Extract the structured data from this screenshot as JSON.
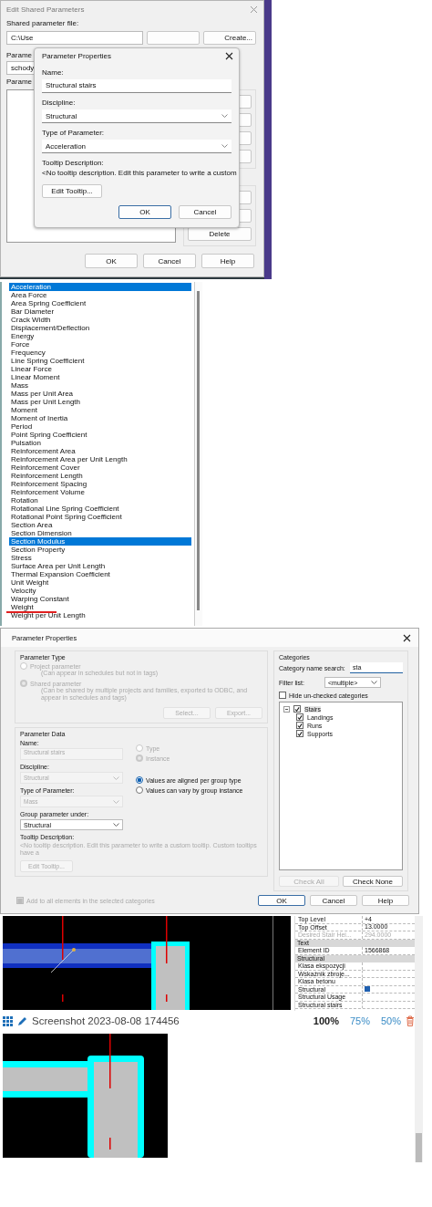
{
  "edit_shared_parameters": {
    "title": "Edit Shared Parameters",
    "file_label": "Shared parameter file:",
    "file_path": "C:\\Use",
    "create_button": "Create...",
    "group_label": "Parame",
    "group_value": "schody",
    "params_label": "Parame",
    "delete_button": "Delete",
    "footer_buttons": [
      "OK",
      "Cancel",
      "Help"
    ]
  },
  "parameter_properties_small": {
    "title": "Parameter Properties",
    "name_label": "Name:",
    "name_value": "Structural stairs",
    "discipline_label": "Discipline:",
    "discipline_value": "Structural",
    "type_label": "Type of Parameter:",
    "type_value": "Acceleration",
    "tooltip_label": "Tooltip Description:",
    "tooltip_text": "<No tooltip description. Edit this parameter to write a custom",
    "edit_tooltip_button": "Edit Tooltip...",
    "ok_button": "OK",
    "cancel_button": "Cancel"
  },
  "parameter_type_list": {
    "items": [
      {
        "label": "Acceleration",
        "selected": true,
        "underlined": false
      },
      {
        "label": "Area Force",
        "selected": false,
        "underlined": false
      },
      {
        "label": "Area Spring Coefficient",
        "selected": false,
        "underlined": false
      },
      {
        "label": "Bar Diameter",
        "selected": false,
        "underlined": false
      },
      {
        "label": "Crack Width",
        "selected": false,
        "underlined": false
      },
      {
        "label": "Displacement/Deflection",
        "selected": false,
        "underlined": false
      },
      {
        "label": "Energy",
        "selected": false,
        "underlined": false
      },
      {
        "label": "Force",
        "selected": false,
        "underlined": false
      },
      {
        "label": "Frequency",
        "selected": false,
        "underlined": false
      },
      {
        "label": "Line Spring Coefficient",
        "selected": false,
        "underlined": false
      },
      {
        "label": "Linear Force",
        "selected": false,
        "underlined": false
      },
      {
        "label": "Linear Moment",
        "selected": false,
        "underlined": false
      },
      {
        "label": "Mass",
        "selected": false,
        "underlined": false
      },
      {
        "label": "Mass per Unit Area",
        "selected": false,
        "underlined": false
      },
      {
        "label": "Mass per Unit Length",
        "selected": false,
        "underlined": false
      },
      {
        "label": "Moment",
        "selected": false,
        "underlined": false
      },
      {
        "label": "Moment of Inertia",
        "selected": false,
        "underlined": false
      },
      {
        "label": "Period",
        "selected": false,
        "underlined": false
      },
      {
        "label": "Point Spring Coefficient",
        "selected": false,
        "underlined": false
      },
      {
        "label": "Pulsation",
        "selected": false,
        "underlined": false
      },
      {
        "label": "Reinforcement Area",
        "selected": false,
        "underlined": false
      },
      {
        "label": "Reinforcement Area per Unit Length",
        "selected": false,
        "underlined": false
      },
      {
        "label": "Reinforcement Cover",
        "selected": false,
        "underlined": false
      },
      {
        "label": "Reinforcement Length",
        "selected": false,
        "underlined": false
      },
      {
        "label": "Reinforcement Spacing",
        "selected": false,
        "underlined": false
      },
      {
        "label": "Reinforcement Volume",
        "selected": false,
        "underlined": false
      },
      {
        "label": "Rotation",
        "selected": false,
        "underlined": false
      },
      {
        "label": "Rotational Line Spring Coefficient",
        "selected": false,
        "underlined": false
      },
      {
        "label": "Rotational Point Spring Coefficient",
        "selected": false,
        "underlined": false
      },
      {
        "label": "Section Area",
        "selected": false,
        "underlined": false
      },
      {
        "label": "Section Dimension",
        "selected": false,
        "underlined": false
      },
      {
        "label": "Section Modulus",
        "selected": true,
        "underlined": false
      },
      {
        "label": "Section Property",
        "selected": false,
        "underlined": false
      },
      {
        "label": "Stress",
        "selected": false,
        "underlined": false
      },
      {
        "label": "Surface Area per Unit Length",
        "selected": false,
        "underlined": false
      },
      {
        "label": "Thermal Expansion Coefficient",
        "selected": false,
        "underlined": false
      },
      {
        "label": "Unit Weight",
        "selected": false,
        "underlined": false
      },
      {
        "label": "Velocity",
        "selected": false,
        "underlined": false
      },
      {
        "label": "Warping Constant",
        "selected": false,
        "underlined": false
      },
      {
        "label": "Weight",
        "selected": false,
        "underlined": true
      },
      {
        "label": "Weight per Unit Length",
        "selected": false,
        "underlined": false
      }
    ]
  },
  "parameter_properties": {
    "title": "Parameter Properties",
    "parameter_type": {
      "heading": "Parameter Type",
      "options": [
        {
          "label": "Project parameter",
          "note": "(Can appear in schedules but not in tags)",
          "selected": false
        },
        {
          "label": "Shared parameter",
          "note": "(Can be shared by multiple projects and families, exported to ODBC, and appear in schedules and tags)",
          "selected": true
        }
      ],
      "buttons": [
        {
          "label": "Select...",
          "disabled": true
        },
        {
          "label": "Export...",
          "disabled": true
        }
      ]
    },
    "parameter_data": {
      "heading": "Parameter Data",
      "name_label": "Name:",
      "name_value": "Structural stairs",
      "discipline_label": "Discipline:",
      "discipline_value": "Structural",
      "type_label": "Type of Parameter:",
      "type_value": "Mass",
      "group_label": "Group parameter under:",
      "group_value": "Structural",
      "scope_options": [
        {
          "label": "Type",
          "selected": false
        },
        {
          "label": "Instance",
          "selected": true
        }
      ],
      "group_options": [
        {
          "label": "Values are aligned per group type",
          "selected": true
        },
        {
          "label": "Values can vary by group instance",
          "selected": false
        }
      ],
      "tooltip_label": "Tooltip Description:",
      "tooltip_text": "<No tooltip description. Edit this parameter to write a custom tooltip. Custom tooltips have a",
      "edit_tooltip_button": "Edit Tooltip..."
    },
    "categories": {
      "heading": "Categories",
      "search_label": "Category name search:",
      "search_value": "sta",
      "filter_label": "Filter list:",
      "filter_value": "<multiple>",
      "hide_unchecked": {
        "label": "Hide un-checked categories",
        "checked": false
      },
      "tree": [
        {
          "label": "Stairs",
          "checked": true,
          "expanded": true,
          "selected": true,
          "children": [
            {
              "label": "Landings",
              "checked": true,
              "selected": false
            },
            {
              "label": "Runs",
              "checked": true,
              "selected": false
            },
            {
              "label": "Supports",
              "checked": true,
              "selected": false
            }
          ]
        }
      ],
      "buttons": [
        {
          "label": "Check All",
          "disabled": true
        },
        {
          "label": "Check None",
          "disabled": false
        }
      ]
    },
    "add_to_all": {
      "label": "Add to all elements in the selected categories",
      "checked": true
    },
    "buttons": [
      {
        "label": "OK",
        "default": true
      },
      {
        "label": "Cancel",
        "default": false
      },
      {
        "label": "Help",
        "default": false
      }
    ]
  },
  "properties_panel": {
    "rows": [
      {
        "kind": "row",
        "label": "Top Level",
        "value": "+4",
        "disabled": false
      },
      {
        "kind": "row",
        "label": "Top Offset",
        "value": "13.0000",
        "disabled": false
      },
      {
        "kind": "row",
        "label": "Desired Stair Hei...",
        "value": "294.0000",
        "disabled": true
      },
      {
        "kind": "header",
        "label": "Text"
      },
      {
        "kind": "row",
        "label": "Element ID",
        "value": "1566868",
        "disabled": false
      },
      {
        "kind": "header",
        "label": "Structural"
      },
      {
        "kind": "row",
        "label": "Klasa ekspozycji",
        "disabled": false
      },
      {
        "kind": "row",
        "label": "Wskaźnik zbroje...",
        "disabled": false
      },
      {
        "kind": "row",
        "label": "Klasa betonu",
        "disabled": false
      },
      {
        "kind": "check",
        "label": "Structural",
        "checked": true
      },
      {
        "kind": "row",
        "label": "Structural Usage",
        "disabled": false
      },
      {
        "kind": "row",
        "label": "Structural stairs",
        "disabled": false
      }
    ]
  },
  "image_viewer": {
    "title": "Screenshot 2023-08-08 174456",
    "zoom_options": [
      {
        "label": "100%",
        "selected": true
      },
      {
        "label": "75%",
        "selected": false
      },
      {
        "label": "50%",
        "selected": false
      }
    ]
  }
}
